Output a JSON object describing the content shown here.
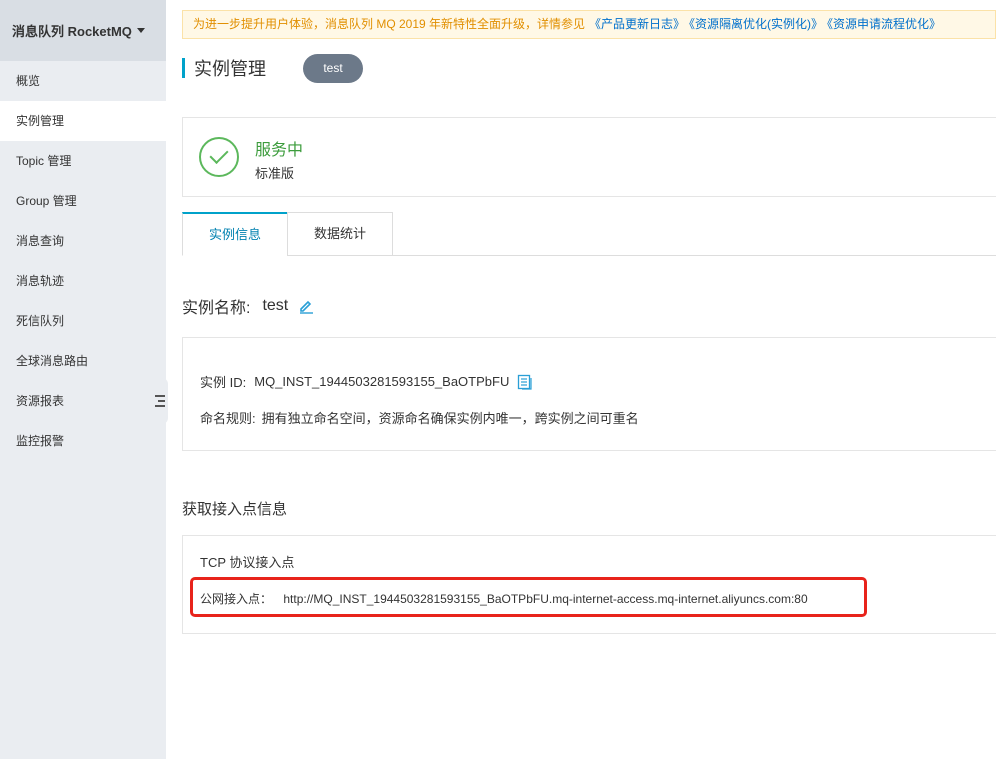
{
  "sidebar": {
    "product_title": "消息队列 RocketMQ",
    "items": [
      {
        "label": "概览"
      },
      {
        "label": "实例管理"
      },
      {
        "label": "Topic 管理"
      },
      {
        "label": "Group 管理"
      },
      {
        "label": "消息查询"
      },
      {
        "label": "消息轨迹"
      },
      {
        "label": "死信队列"
      },
      {
        "label": "全球消息路由"
      },
      {
        "label": "资源报表"
      },
      {
        "label": "监控报警"
      }
    ],
    "active_index": 1
  },
  "notice": {
    "text": "为进一步提升用户体验，消息队列 MQ 2019 年新特性全面升级，详情参见",
    "links": [
      "《产品更新日志》",
      "《资源隔离优化(实例化)》",
      "《资源申请流程优化》"
    ]
  },
  "page": {
    "title": "实例管理",
    "instance_selector": "test"
  },
  "status": {
    "state": "服务中",
    "edition": "标准版",
    "color": "#3c9c3c"
  },
  "tabs": [
    {
      "label": "实例信息",
      "active": true
    },
    {
      "label": "数据统计",
      "active": false
    }
  ],
  "instance": {
    "name_label": "实例名称:",
    "name_value": "test",
    "id_label": "实例 ID:",
    "id_value": "MQ_INST_1944503281593155_BaOTPbFU",
    "naming_rule_label": "命名规则:",
    "naming_rule_value": "拥有独立命名空间，资源命名确保实例内唯一，跨实例之间可重名"
  },
  "endpoint": {
    "section_title": "获取接入点信息",
    "protocol_label": "TCP 协议接入点",
    "public_label": "公网接入点：",
    "public_url": "http://MQ_INST_1944503281593155_BaOTPbFU.mq-internet-access.mq-internet.aliyuncs.com:80",
    "highlight_color": "#e8231b"
  },
  "icons": {
    "edit": "pencil-icon",
    "copy": "copy-icon",
    "status": "check-circle-icon",
    "collapse": "sidebar-collapse-icon"
  },
  "colors": {
    "accent": "#00a2ca",
    "link": "#0070cc",
    "notice_text": "#e18f00"
  }
}
